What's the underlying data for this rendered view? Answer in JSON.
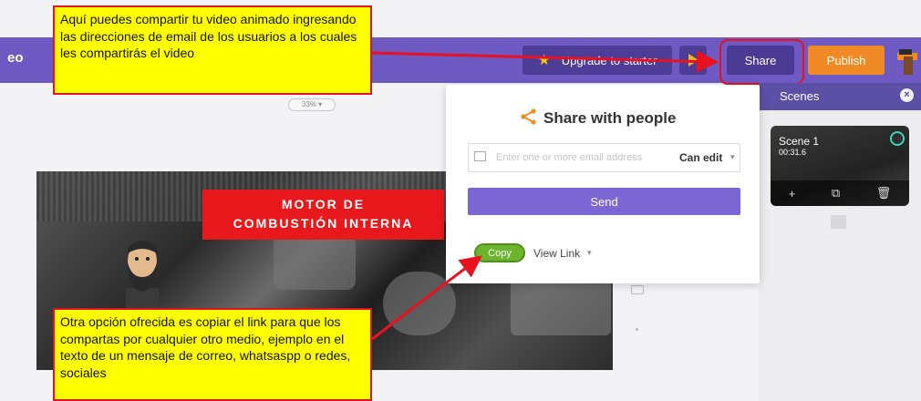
{
  "app": {
    "tag": "eo"
  },
  "topbar": {
    "upgrade_label": "Upgrade to starter",
    "share_label": "Share",
    "publish_label": "Publish"
  },
  "scenes": {
    "title": "Scenes",
    "close_glyph": "×",
    "items": [
      {
        "name": "Scene 1",
        "duration": "00:31.6"
      }
    ],
    "toolbar": {
      "add": "+",
      "duplicate": "⧉",
      "delete": "🗑"
    }
  },
  "canvas": {
    "zoom": "33% ▾",
    "title_line1": "MOTOR DE",
    "title_line2": "COMBUSTIÓN INTERNA"
  },
  "share_dialog": {
    "title": "Share with people",
    "email_placeholder": "Enter one or more email address",
    "permission": "Can edit",
    "send_label": "Send",
    "copy_label": "Copy",
    "view_link_label": "View Link"
  },
  "annotations": {
    "top": "Aquí puedes compartir tu video animado ingresando las direcciones de email de los usuarios a los cuales les compartirás el video",
    "bottom": "Otra opción ofrecida es copiar el link para que los compartas por cualquier otro medio, ejemplo en el texto de un mensaje de correo, whatsaspp o redes, sociales"
  },
  "colors": {
    "topbar": "#6e5ac2",
    "accent": "#7b67d4",
    "publish": "#f08a25",
    "copy": "#6cb42d",
    "note_bg": "#ffff00",
    "note_border": "#e0141d"
  },
  "icons": [
    "star-icon",
    "preview-play-icon",
    "share-icon",
    "mail-icon",
    "close-icon",
    "chevron-down-icon"
  ]
}
